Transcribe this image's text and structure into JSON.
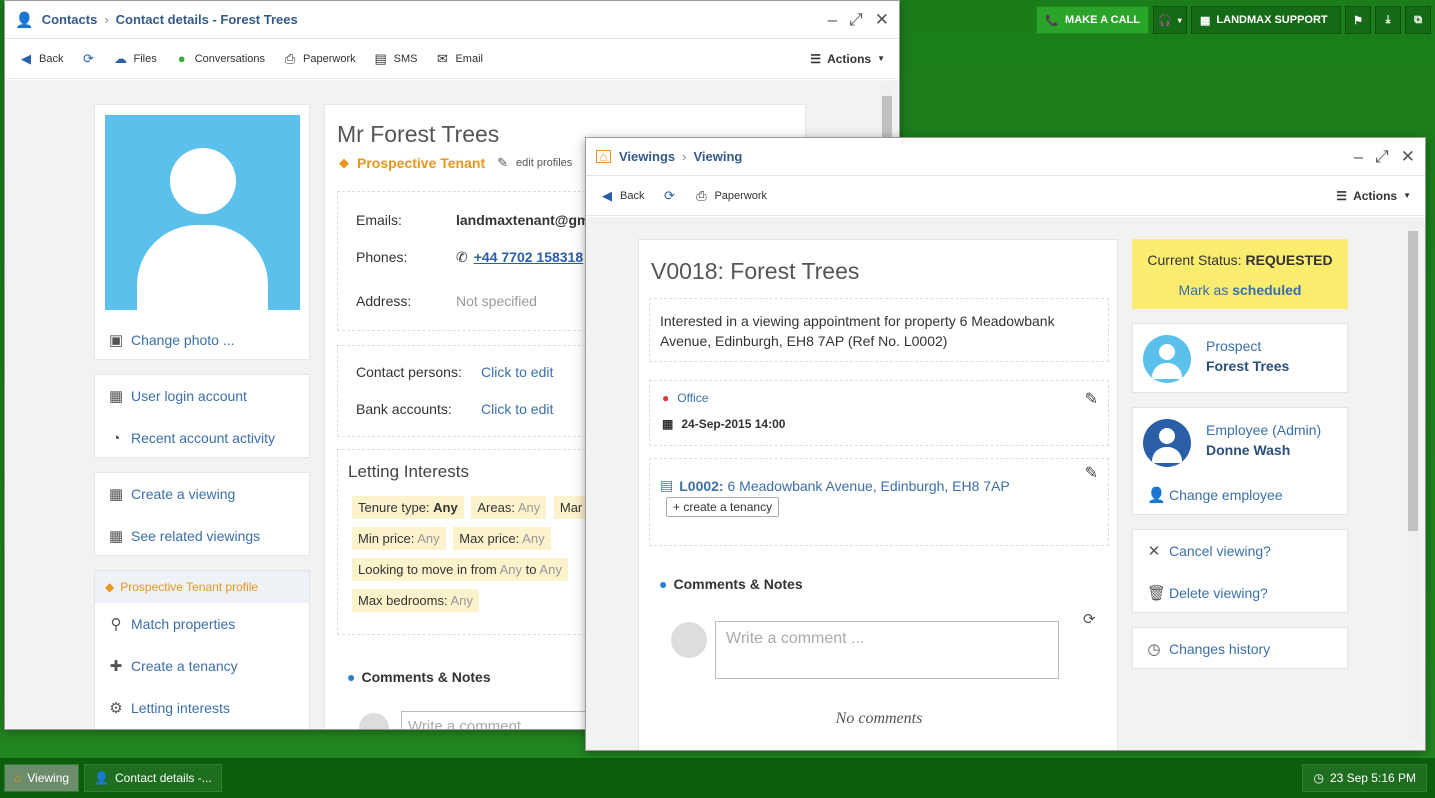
{
  "topbar": {
    "make_call": "MAKE A CALL",
    "support": "LANDMAX SUPPORT"
  },
  "contact_window": {
    "breadcrumb_root": "Contacts",
    "breadcrumb_sep": "›",
    "title": "Contact details - Forest Trees",
    "toolbar": {
      "back": "Back",
      "files": "Files",
      "conversations": "Conversations",
      "paperwork": "Paperwork",
      "sms": "SMS",
      "email": "Email",
      "actions": "Actions"
    },
    "sidebar": {
      "change_photo": "Change photo ...",
      "user_login": "User login account",
      "recent_activity": "Recent account activity",
      "create_viewing": "Create a viewing",
      "see_viewings": "See related viewings",
      "profile_header": "Prospective Tenant profile",
      "match_properties": "Match properties",
      "create_tenancy": "Create a tenancy",
      "letting_interests": "Letting interests"
    },
    "name": "Mr Forest Trees",
    "profile_tag": "Prospective Tenant",
    "edit_profiles": "edit profiles",
    "emails_label": "Emails:",
    "emails_value": "landmaxtenant@gm",
    "phones_label": "Phones:",
    "phones_value": "+44 7702 158318",
    "address_label": "Address:",
    "address_value": "Not specified",
    "contact_persons_label": "Contact persons:",
    "contact_persons_value": "Click to edit",
    "bank_label": "Bank accounts:",
    "bank_value": "Click to edit",
    "letting_title": "Letting Interests",
    "tags": {
      "tenure_label": "Tenure type:",
      "tenure_value": "Any",
      "areas_label": "Areas:",
      "areas_value": "Any",
      "mar": "Mar",
      "min_label": "Min price:",
      "min_value": "Any",
      "max_label": "Max price:",
      "max_value": "Any",
      "move_label": "Looking to move in from",
      "move_from": "Any",
      "move_to": "to",
      "move_to_value": "Any",
      "bed_label": "Max bedrooms:",
      "bed_value": "Any"
    },
    "comments_title": "Comments & Notes",
    "comment_placeholder": "Write a comment ..."
  },
  "viewing_window": {
    "breadcrumb_root": "Viewings",
    "breadcrumb_sep": "›",
    "title": "Viewing",
    "toolbar": {
      "back": "Back",
      "paperwork": "Paperwork",
      "actions": "Actions"
    },
    "heading": "V0018: Forest Trees",
    "description": "Interested in a viewing appointment for property 6 Meadowbank Avenue, Edinburgh, EH8 7AP (Ref No. L0002)",
    "location": "Office",
    "datetime": "24-Sep-2015 14:00",
    "property_ref": "L0002:",
    "property_address": "6 Meadowbank Avenue, Edinburgh, EH8 7AP",
    "create_tenancy": "+ create a tenancy",
    "comments_title": "Comments & Notes",
    "comment_placeholder": "Write a comment ...",
    "no_comments": "No comments",
    "status_label": "Current Status:",
    "status_value": "REQUESTED",
    "mark_as": "Mark as",
    "mark_status": "scheduled",
    "prospect_role": "Prospect",
    "prospect_name": "Forest Trees",
    "employee_role": "Employee (Admin)",
    "employee_name": "Donne Wash",
    "change_employee": "Change employee",
    "cancel_viewing": "Cancel viewing?",
    "delete_viewing": "Delete viewing?",
    "changes_history": "Changes history"
  },
  "taskbar": {
    "task1": "Viewing",
    "task2": "Contact details -...",
    "clock": "23 Sep 5:16 PM"
  },
  "colors": {
    "link": "#3a6fa8",
    "orange": "#e8961e",
    "status_bg": "#f9ec6e",
    "avatar": "#5bc0eb",
    "desktop": "#1e7a1e"
  }
}
